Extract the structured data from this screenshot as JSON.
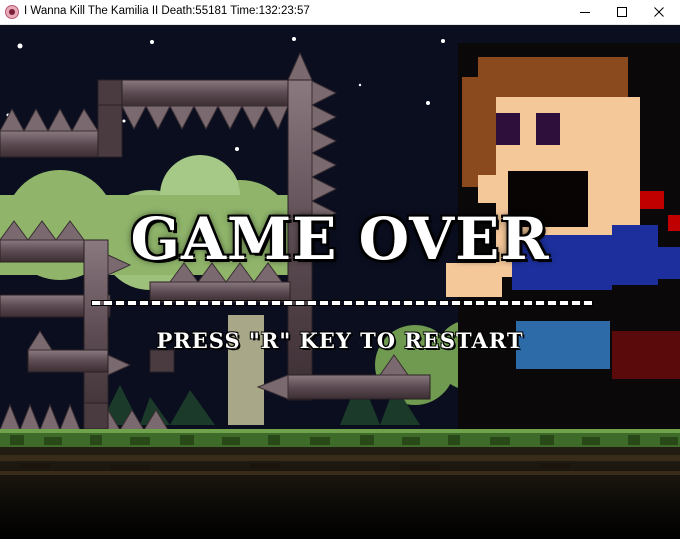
{
  "window": {
    "title": "I Wanna Kill The Kamilia II Death:55181 Time:132:23:57",
    "controls": [
      "minimize",
      "maximize",
      "close"
    ]
  },
  "overlay": {
    "heading": "GAME OVER",
    "prompt": "PRESS \"R\" KEY TO RESTART"
  },
  "colors": {
    "sky": "#0a0e1f",
    "block": "#6b5a60",
    "spike": "#7a6a6f",
    "grass": "#3f6b2a",
    "tree": "#8fb46a",
    "skin": "#f5c89a",
    "hair": "#8b4a1e",
    "shirt": "#1c2f9c",
    "text": "#ffffff"
  }
}
